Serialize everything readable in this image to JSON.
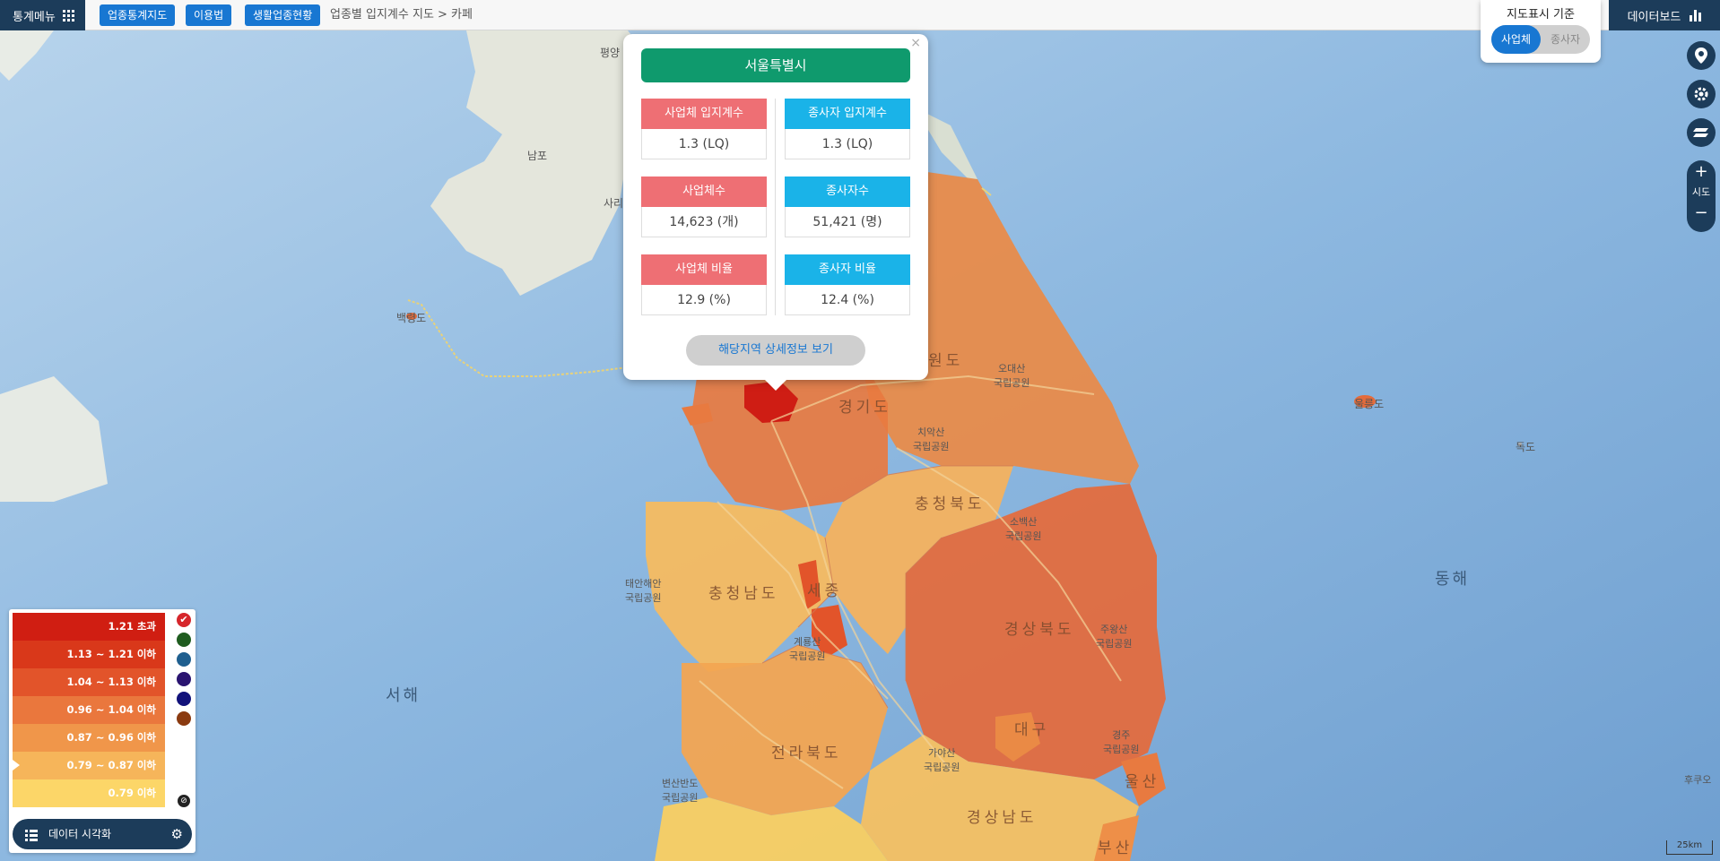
{
  "topbar": {
    "menu_label": "통계메뉴",
    "chips": [
      "업종통계지도",
      "이용법",
      "생활업종현황"
    ],
    "breadcrumb": "업종별 입지계수 지도 > 카페",
    "dashboard_label": "데이터보드"
  },
  "basis_panel": {
    "title": "지도표시 기준",
    "options": [
      "사업체",
      "종사자"
    ],
    "selected": "사업체"
  },
  "tools": {
    "zoom_in": "+",
    "zoom_level_label": "시도",
    "zoom_out": "−",
    "icons": [
      "location-icon",
      "settings-icon",
      "layer-icon"
    ]
  },
  "popup": {
    "close": "×",
    "region": "서울특별시",
    "stats": [
      {
        "label": "사업체 입지계수",
        "value": "1.3 (LQ)",
        "color": "red"
      },
      {
        "label": "종사자 입지계수",
        "value": "1.3 (LQ)",
        "color": "blue"
      },
      {
        "label": "사업체수",
        "value": "14,623 (개)",
        "color": "red"
      },
      {
        "label": "종사자수",
        "value": "51,421 (명)",
        "color": "blue"
      },
      {
        "label": "사업체 비율",
        "value": "12.9 (%)",
        "color": "red"
      },
      {
        "label": "종사자 비율",
        "value": "12.4 (%)",
        "color": "blue"
      }
    ],
    "detail_button": "해당지역 상세정보 보기"
  },
  "legend": {
    "rows": [
      {
        "label": "1.21 초과",
        "color": "#d01e12"
      },
      {
        "label": "1.13 ~ 1.21 이하",
        "color": "#d9381a"
      },
      {
        "label": "1.04 ~ 1.13 이하",
        "color": "#e2542a"
      },
      {
        "label": "0.96 ~ 1.04 이하",
        "color": "#ea773d"
      },
      {
        "label": "0.87 ~ 0.96 이하",
        "color": "#f0964a"
      },
      {
        "label": "0.79 ~ 0.87 이하",
        "color": "#f6b55a"
      },
      {
        "label": "0.79 이하",
        "color": "#fcd668"
      }
    ],
    "swatches": [
      "#d6262b",
      "#1f5c1f",
      "#1f5f8f",
      "#2a1470",
      "#12127a",
      "#8a3a10"
    ],
    "check_mark": "✔",
    "reset_icon": "⊘",
    "vis_label": "데이터 시각화",
    "gear_icon": "⚙"
  },
  "map_labels": {
    "east_sea": "동해",
    "west_sea": "서해",
    "gyeonggi": "경기도",
    "gangwon": "원도",
    "chungbuk": "충청북도",
    "chungnam": "충청남도",
    "gyeongbuk": "경상북도",
    "gyeongnam": "경상남도",
    "jeonbuk": "전라북도",
    "daegu": "대구",
    "ulsan": "울산",
    "busan": "부산",
    "sejong": "세종",
    "ulleung": "울릉도",
    "dokdo": "독도",
    "baengnyeong": "백령도",
    "pyeongyang": "평양",
    "nampo": "남포",
    "sariwon": "사리원",
    "taean": "태안해안\n국립공원",
    "sobaek": "소백산\n국립공원",
    "juwang": "주왕산\n국립공원",
    "gyeongju": "경주\n국립공원",
    "byeonsan": "변산반도\n국립공원",
    "gaya": "가야산\n국립공원",
    "odae": "오대산\n국립공원",
    "chiak": "치악산\n국립공원",
    "gyeryong": "계룡산\n국립공원",
    "fukuoka": "후쿠오"
  },
  "scale": "25km"
}
